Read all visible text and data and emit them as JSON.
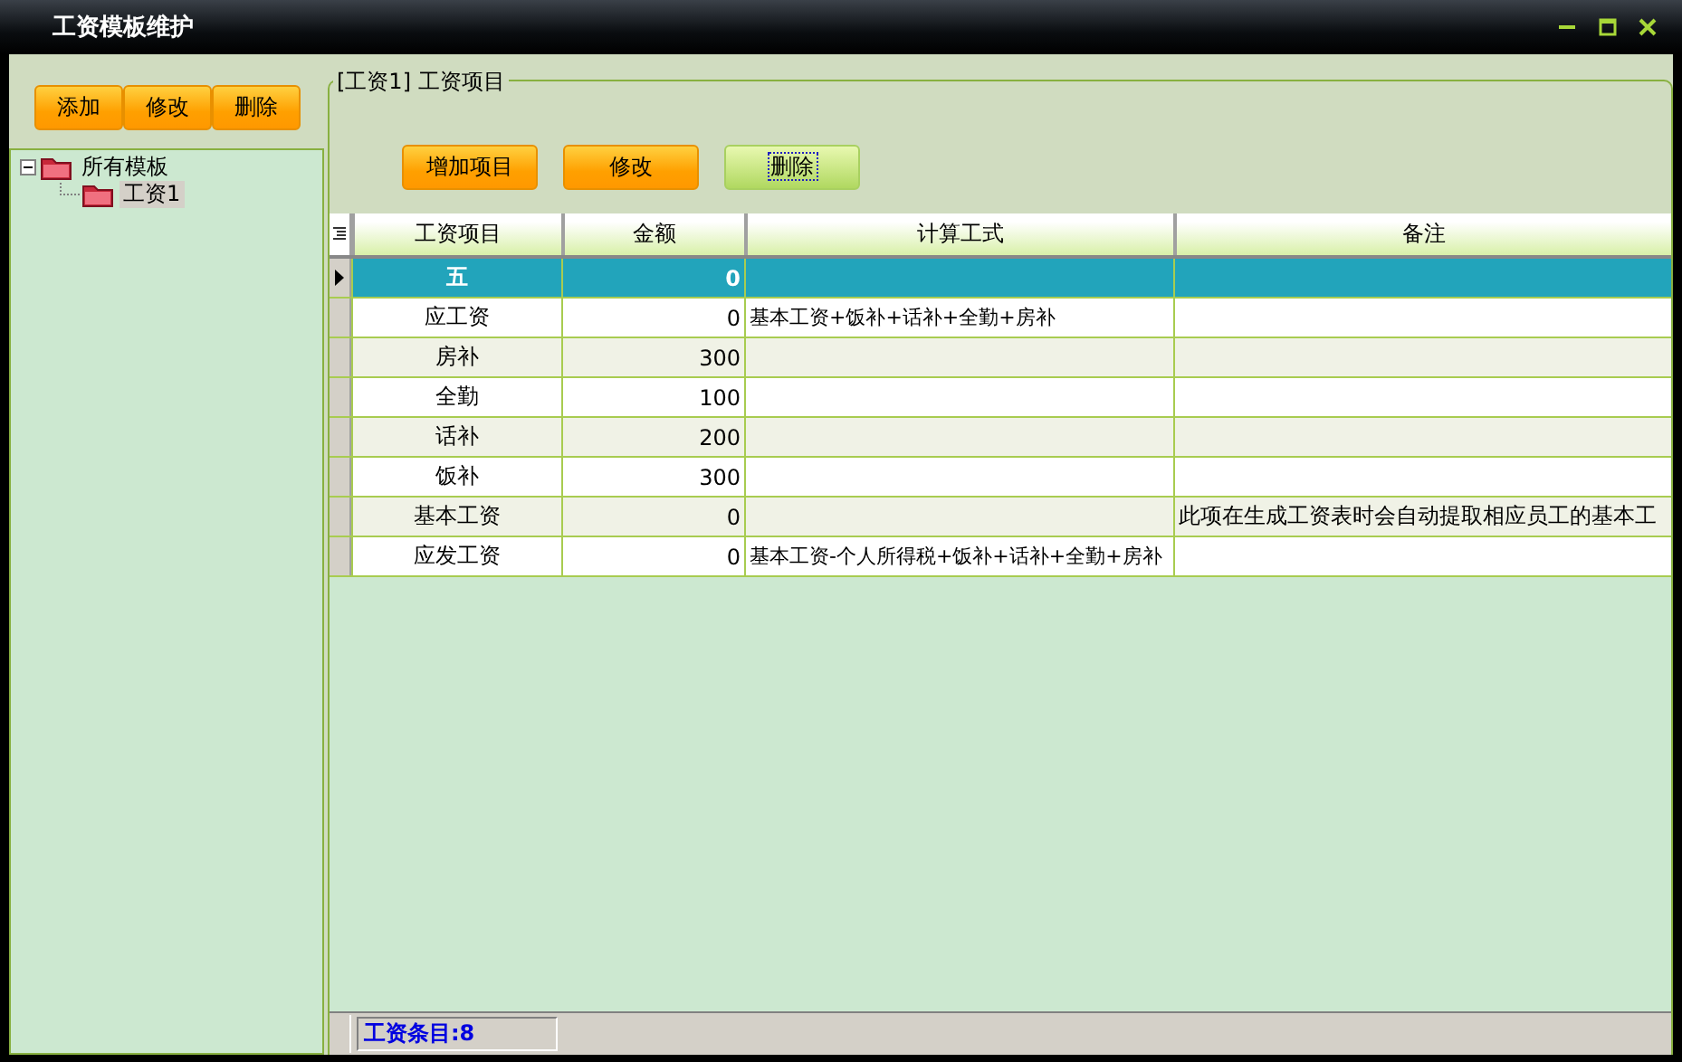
{
  "window": {
    "title": "工资模板维护"
  },
  "left_toolbar": [
    {
      "label": "添加"
    },
    {
      "label": "修改"
    },
    {
      "label": "删除"
    }
  ],
  "tree": [
    {
      "label": "所有模板",
      "expanded": true,
      "children": [
        {
          "label": "工资1",
          "selected": true
        }
      ]
    }
  ],
  "group": {
    "title": "[工资1] 工资项目"
  },
  "item_toolbar": [
    {
      "label": "增加项目",
      "focused": false
    },
    {
      "label": "修改",
      "focused": false
    },
    {
      "label": "删除",
      "focused": true
    }
  ],
  "table": {
    "columns": [
      "工资项目",
      "金额",
      "计算工式",
      "备注"
    ],
    "rows": [
      {
        "cells": [
          "五",
          "0",
          "",
          ""
        ],
        "selected": true
      },
      {
        "cells": [
          "应工资",
          "0",
          "基本工资+饭补+话补+全勤+房补",
          ""
        ],
        "selected": false
      },
      {
        "cells": [
          "房补",
          "300",
          "",
          ""
        ],
        "selected": false
      },
      {
        "cells": [
          "全勤",
          "100",
          "",
          ""
        ],
        "selected": false
      },
      {
        "cells": [
          "话补",
          "200",
          "",
          ""
        ],
        "selected": false
      },
      {
        "cells": [
          "饭补",
          "300",
          "",
          ""
        ],
        "selected": false
      },
      {
        "cells": [
          "基本工资",
          "0",
          "",
          "此项在生成工资表时会自动提取相应员工的基本工"
        ],
        "selected": false
      },
      {
        "cells": [
          "应发工资",
          "0",
          "基本工资-个人所得税+饭补+话补+全勤+房补",
          ""
        ],
        "selected": false
      }
    ]
  },
  "status_bar": {
    "text": "工资条目:8"
  }
}
